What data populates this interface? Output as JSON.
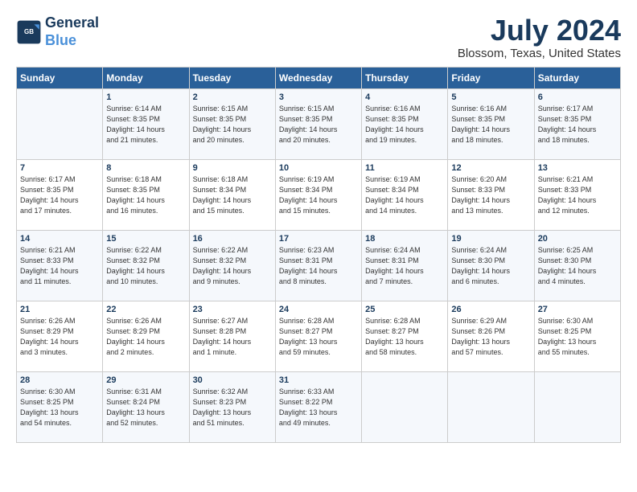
{
  "header": {
    "logo_line1": "General",
    "logo_line2": "Blue",
    "month_year": "July 2024",
    "location": "Blossom, Texas, United States"
  },
  "weekdays": [
    "Sunday",
    "Monday",
    "Tuesday",
    "Wednesday",
    "Thursday",
    "Friday",
    "Saturday"
  ],
  "weeks": [
    [
      {
        "day": "",
        "info": ""
      },
      {
        "day": "1",
        "info": "Sunrise: 6:14 AM\nSunset: 8:35 PM\nDaylight: 14 hours\nand 21 minutes."
      },
      {
        "day": "2",
        "info": "Sunrise: 6:15 AM\nSunset: 8:35 PM\nDaylight: 14 hours\nand 20 minutes."
      },
      {
        "day": "3",
        "info": "Sunrise: 6:15 AM\nSunset: 8:35 PM\nDaylight: 14 hours\nand 20 minutes."
      },
      {
        "day": "4",
        "info": "Sunrise: 6:16 AM\nSunset: 8:35 PM\nDaylight: 14 hours\nand 19 minutes."
      },
      {
        "day": "5",
        "info": "Sunrise: 6:16 AM\nSunset: 8:35 PM\nDaylight: 14 hours\nand 18 minutes."
      },
      {
        "day": "6",
        "info": "Sunrise: 6:17 AM\nSunset: 8:35 PM\nDaylight: 14 hours\nand 18 minutes."
      }
    ],
    [
      {
        "day": "7",
        "info": "Sunrise: 6:17 AM\nSunset: 8:35 PM\nDaylight: 14 hours\nand 17 minutes."
      },
      {
        "day": "8",
        "info": "Sunrise: 6:18 AM\nSunset: 8:35 PM\nDaylight: 14 hours\nand 16 minutes."
      },
      {
        "day": "9",
        "info": "Sunrise: 6:18 AM\nSunset: 8:34 PM\nDaylight: 14 hours\nand 15 minutes."
      },
      {
        "day": "10",
        "info": "Sunrise: 6:19 AM\nSunset: 8:34 PM\nDaylight: 14 hours\nand 15 minutes."
      },
      {
        "day": "11",
        "info": "Sunrise: 6:19 AM\nSunset: 8:34 PM\nDaylight: 14 hours\nand 14 minutes."
      },
      {
        "day": "12",
        "info": "Sunrise: 6:20 AM\nSunset: 8:33 PM\nDaylight: 14 hours\nand 13 minutes."
      },
      {
        "day": "13",
        "info": "Sunrise: 6:21 AM\nSunset: 8:33 PM\nDaylight: 14 hours\nand 12 minutes."
      }
    ],
    [
      {
        "day": "14",
        "info": "Sunrise: 6:21 AM\nSunset: 8:33 PM\nDaylight: 14 hours\nand 11 minutes."
      },
      {
        "day": "15",
        "info": "Sunrise: 6:22 AM\nSunset: 8:32 PM\nDaylight: 14 hours\nand 10 minutes."
      },
      {
        "day": "16",
        "info": "Sunrise: 6:22 AM\nSunset: 8:32 PM\nDaylight: 14 hours\nand 9 minutes."
      },
      {
        "day": "17",
        "info": "Sunrise: 6:23 AM\nSunset: 8:31 PM\nDaylight: 14 hours\nand 8 minutes."
      },
      {
        "day": "18",
        "info": "Sunrise: 6:24 AM\nSunset: 8:31 PM\nDaylight: 14 hours\nand 7 minutes."
      },
      {
        "day": "19",
        "info": "Sunrise: 6:24 AM\nSunset: 8:30 PM\nDaylight: 14 hours\nand 6 minutes."
      },
      {
        "day": "20",
        "info": "Sunrise: 6:25 AM\nSunset: 8:30 PM\nDaylight: 14 hours\nand 4 minutes."
      }
    ],
    [
      {
        "day": "21",
        "info": "Sunrise: 6:26 AM\nSunset: 8:29 PM\nDaylight: 14 hours\nand 3 minutes."
      },
      {
        "day": "22",
        "info": "Sunrise: 6:26 AM\nSunset: 8:29 PM\nDaylight: 14 hours\nand 2 minutes."
      },
      {
        "day": "23",
        "info": "Sunrise: 6:27 AM\nSunset: 8:28 PM\nDaylight: 14 hours\nand 1 minute."
      },
      {
        "day": "24",
        "info": "Sunrise: 6:28 AM\nSunset: 8:27 PM\nDaylight: 13 hours\nand 59 minutes."
      },
      {
        "day": "25",
        "info": "Sunrise: 6:28 AM\nSunset: 8:27 PM\nDaylight: 13 hours\nand 58 minutes."
      },
      {
        "day": "26",
        "info": "Sunrise: 6:29 AM\nSunset: 8:26 PM\nDaylight: 13 hours\nand 57 minutes."
      },
      {
        "day": "27",
        "info": "Sunrise: 6:30 AM\nSunset: 8:25 PM\nDaylight: 13 hours\nand 55 minutes."
      }
    ],
    [
      {
        "day": "28",
        "info": "Sunrise: 6:30 AM\nSunset: 8:25 PM\nDaylight: 13 hours\nand 54 minutes."
      },
      {
        "day": "29",
        "info": "Sunrise: 6:31 AM\nSunset: 8:24 PM\nDaylight: 13 hours\nand 52 minutes."
      },
      {
        "day": "30",
        "info": "Sunrise: 6:32 AM\nSunset: 8:23 PM\nDaylight: 13 hours\nand 51 minutes."
      },
      {
        "day": "31",
        "info": "Sunrise: 6:33 AM\nSunset: 8:22 PM\nDaylight: 13 hours\nand 49 minutes."
      },
      {
        "day": "",
        "info": ""
      },
      {
        "day": "",
        "info": ""
      },
      {
        "day": "",
        "info": ""
      }
    ]
  ]
}
